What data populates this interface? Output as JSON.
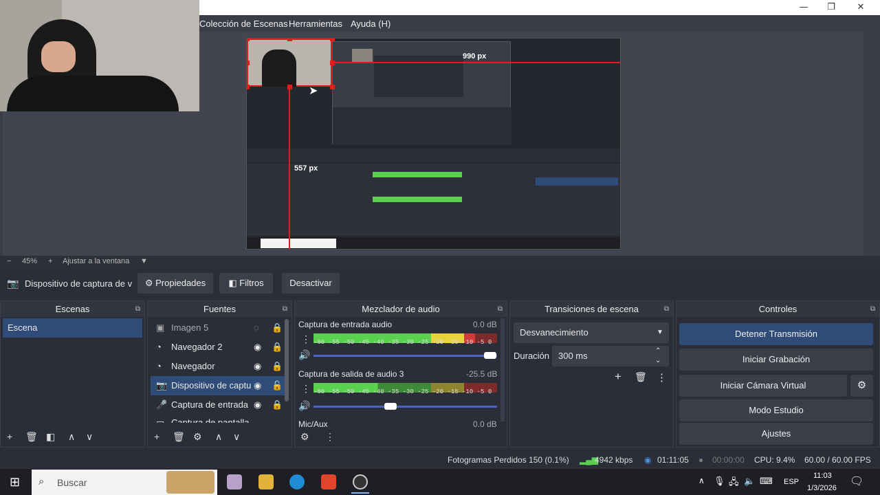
{
  "window": {
    "min": "—",
    "max": "❐",
    "close": "✕"
  },
  "menu": [
    "Colección de Escenas",
    "Herramientas",
    "Ayuda (H)"
  ],
  "preview": {
    "dim_h": "990 px",
    "dim_v": "557 px"
  },
  "zoom": {
    "minus": "−",
    "level": "45%",
    "plus": "+",
    "fit": "Ajustar a la ventana"
  },
  "source_bar": {
    "name": "Dispositivo de captura de v",
    "properties": "Propiedades",
    "filters": "Filtros",
    "deactivate": "Desactivar"
  },
  "docks": {
    "scenes": {
      "title": "Escenas",
      "items": [
        "Escena"
      ]
    },
    "sources": {
      "title": "Fuentes",
      "items": [
        {
          "label": "Imagen 5",
          "icon": "image-icon"
        },
        {
          "label": "Navegador 2",
          "icon": "globe-icon"
        },
        {
          "label": "Navegador",
          "icon": "globe-icon"
        },
        {
          "label": "Dispositivo de captu",
          "icon": "camera-icon"
        },
        {
          "label": "Captura de entrada",
          "icon": "mic-icon"
        },
        {
          "label": "Captura de pantalla",
          "icon": "monitor-icon"
        }
      ]
    },
    "mixer": {
      "title": "Mezclador de audio",
      "channels": [
        {
          "name": "Captura de entrada audio",
          "db": "0.0 dB",
          "level": 0.88
        },
        {
          "name": "Captura de salida de audio 3",
          "db": "-25.5 dB",
          "level": 0.35
        },
        {
          "name": "Mic/Aux",
          "db": "0.0 dB",
          "level": 0.0
        }
      ],
      "ticks": [
        "-60",
        "-55",
        "-50",
        "-45",
        "-40",
        "-35",
        "-30",
        "-25",
        "-20",
        "-15",
        "-10",
        "-5",
        "0"
      ]
    },
    "transitions": {
      "title": "Transiciones de escena",
      "selected": "Desvanecimiento",
      "duration_label": "Duración",
      "duration_value": "300 ms"
    },
    "controls": {
      "title": "Controles",
      "stop_stream": "Detener Transmisión",
      "start_record": "Iniciar Grabación",
      "virtual_cam": "Iniciar Cámara Virtual",
      "studio": "Modo Estudio",
      "settings": "Ajustes"
    }
  },
  "status": {
    "dropped": "Fotogramas Perdidos 150 (0.1%)",
    "kbps": "4942 kbps",
    "live_time": "01:11:05",
    "rec_time": "00:00:00",
    "cpu": "CPU: 9.4%",
    "fps": "60.00 / 60.00 FPS"
  },
  "taskbar": {
    "search_placeholder": "Buscar",
    "lang": "ESP",
    "time": "11:03",
    "date": "1/3/2026"
  },
  "colors": {
    "accent": "#2f4b78",
    "selection_red": "#e31b1b",
    "panel": "#2b2e38"
  }
}
